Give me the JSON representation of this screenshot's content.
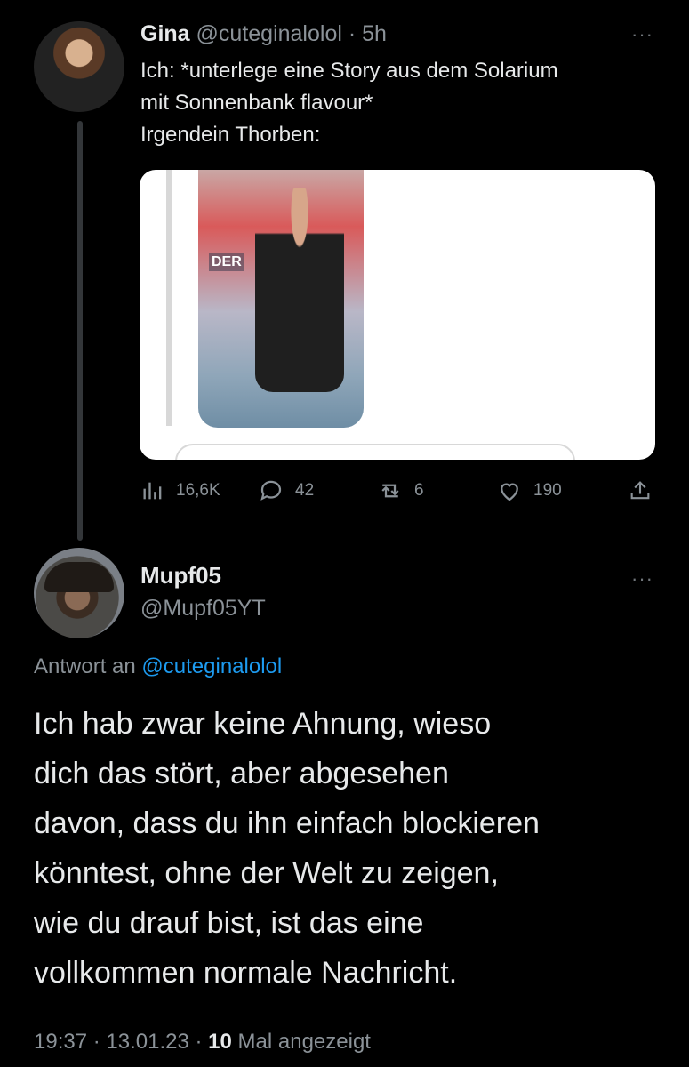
{
  "original_tweet": {
    "name": "Gina",
    "handle": "@cuteginalolol",
    "separator": "·",
    "time": "5h",
    "more": "···",
    "text_lines": [
      "Ich: *unterlege eine Story aus dem Solarium",
      "mit Sonnenbank flavour*",
      "Irgendein Thorben:"
    ],
    "media": {
      "overlay_text": "DER"
    },
    "stats": {
      "views": "16,6K",
      "replies": "42",
      "retweets": "6",
      "likes": "190"
    },
    "icons": [
      "views-icon",
      "reply-icon",
      "retweet-icon",
      "like-icon",
      "share-icon"
    ]
  },
  "reply_tweet": {
    "name": "Mupf05",
    "handle": "@Mupf05YT",
    "more": "···",
    "reply_prefix": "Antwort an",
    "reply_mention": "@cuteginalolol",
    "text_lines": [
      "Ich hab zwar keine Ahnung, wieso",
      "dich das stört, aber abgesehen",
      "davon, dass du ihn einfach blockieren",
      "könntest, ohne der Welt zu zeigen,",
      "wie du drauf bist, ist das eine",
      "vollkommen normale Nachricht."
    ],
    "time": "19:37",
    "date": "13.01.23",
    "separator": "·",
    "views_count": "10",
    "views_label": "Mal angezeigt"
  },
  "colors": {
    "background": "#000000",
    "text": "#e7e9ea",
    "muted": "#8b9298",
    "link": "#1d9bf0"
  }
}
